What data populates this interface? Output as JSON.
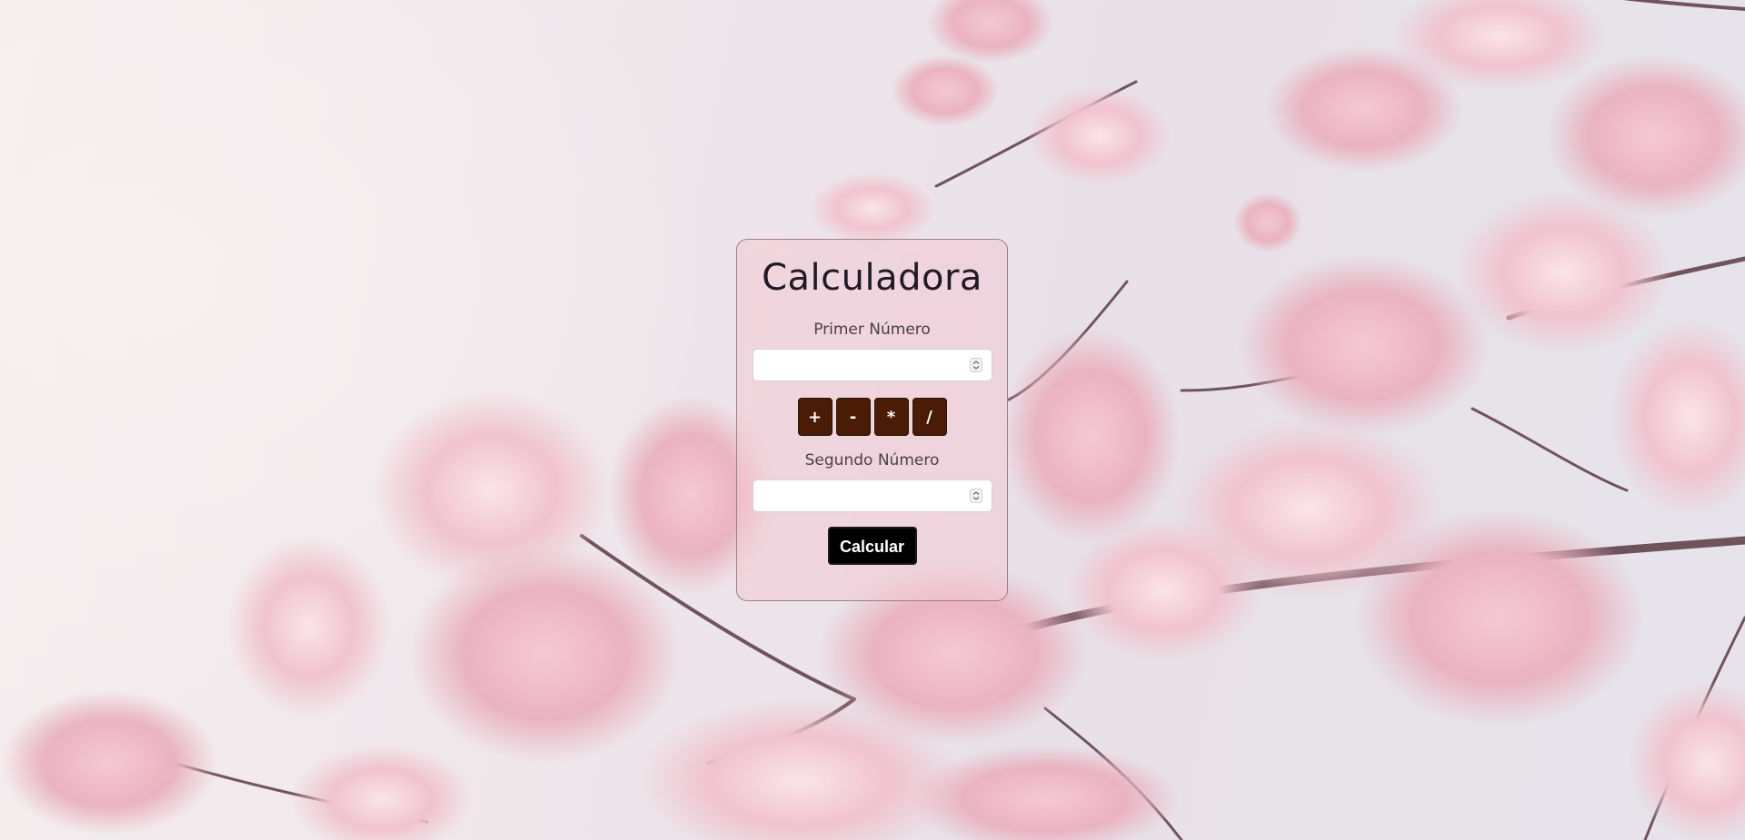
{
  "calculator": {
    "title": "Calculadora",
    "first_label": "Primer Número",
    "first_value": "",
    "second_label": "Segundo Número",
    "second_value": "",
    "operators": [
      "+",
      "-",
      "*",
      "/"
    ],
    "calculate_label": "Calcular"
  },
  "colors": {
    "operator_button": "#4a1c05",
    "calculate_button": "#000000",
    "card_tint": "#f2c8d4"
  }
}
